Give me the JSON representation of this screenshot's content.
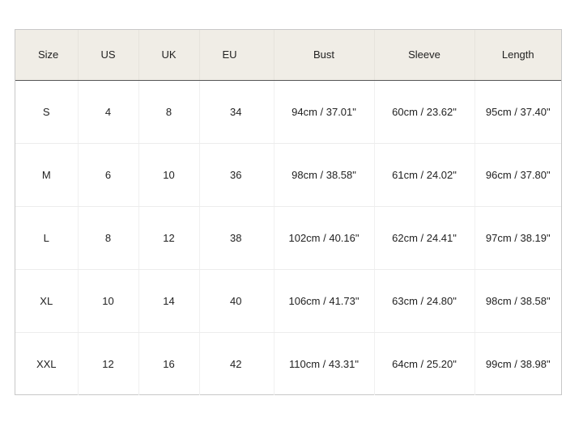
{
  "table": {
    "headers": [
      "Size",
      "US",
      "UK",
      "EU",
      "Bust",
      "Sleeve",
      "Length"
    ],
    "rows": [
      {
        "size": "S",
        "us": "4",
        "uk": "8",
        "eu": "34",
        "bust": "94cm / 37.01\"",
        "sleeve": "60cm / 23.62\"",
        "length": "95cm / 37.40\""
      },
      {
        "size": "M",
        "us": "6",
        "uk": "10",
        "eu": "36",
        "bust": "98cm / 38.58\"",
        "sleeve": "61cm / 24.02\"",
        "length": "96cm / 37.80\""
      },
      {
        "size": "L",
        "us": "8",
        "uk": "12",
        "eu": "38",
        "bust": "102cm / 40.16\"",
        "sleeve": "62cm / 24.41\"",
        "length": "97cm / 38.19\""
      },
      {
        "size": "XL",
        "us": "10",
        "uk": "14",
        "eu": "40",
        "bust": "106cm / 41.73\"",
        "sleeve": "63cm / 24.80\"",
        "length": "98cm / 38.58\""
      },
      {
        "size": "XXL",
        "us": "12",
        "uk": "16",
        "eu": "42",
        "bust": "110cm / 43.31\"",
        "sleeve": "64cm / 25.20\"",
        "length": "99cm / 38.98\""
      }
    ]
  },
  "colors": {
    "header_background": "#f0ede6",
    "header_rule": "#555555",
    "grid_line": "#ececec",
    "text": "#222222"
  }
}
